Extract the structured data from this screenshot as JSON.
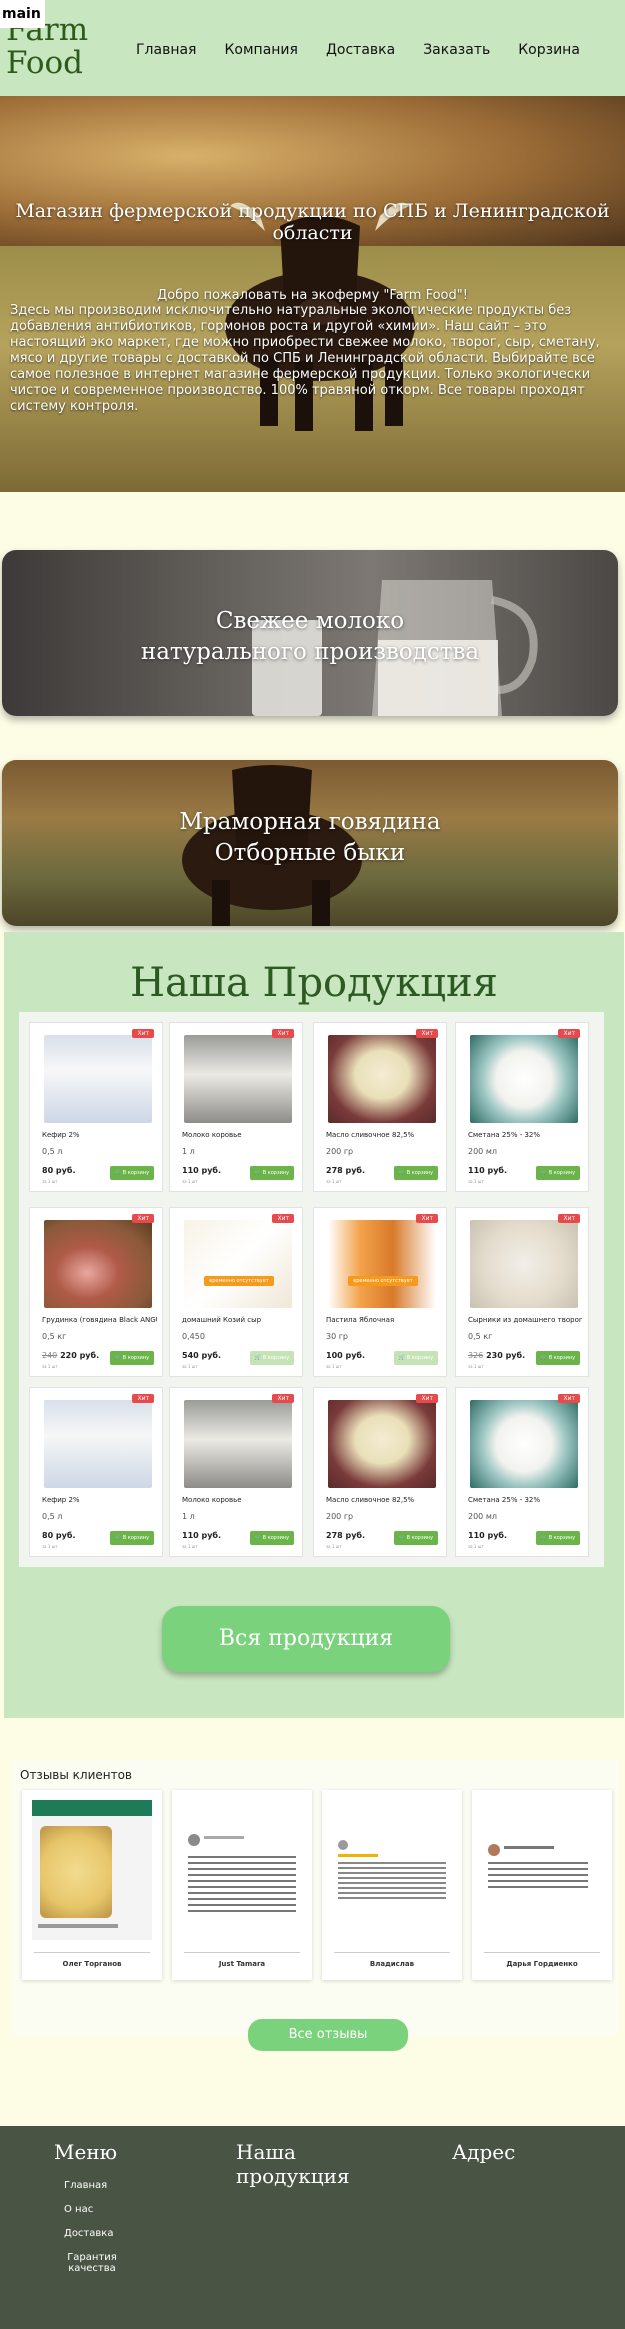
{
  "skip_link": "main",
  "header": {
    "logo_line1": "Farm",
    "logo_line2": "Food",
    "nav": [
      "Главная",
      "Компания",
      "Доставка",
      "Заказать",
      "Корзина"
    ]
  },
  "hero": {
    "title": "Магазин фермерской продукции по СПБ и Ленинградской области",
    "welcome": "Добро пожаловать на экоферму \"Farm Food\"!",
    "description": "Здесь мы производим исключительно натуральные экологические продукты без добавления антибиотиков, гормонов роста и другой «химии». Наш сайт – это настоящий эко маркет, где можно приобрести свежее молоко, творог, сыр, сметану, мясо и другие товары с доставкой по СПБ и Ленинградской области. Выбирайте все самое полезное в интернет магазине фермерской продукции. Только экологически чистое и современное производство. 100% травяной откорм. Все товары проходят систему контроля."
  },
  "banners": [
    {
      "line1": "Свежее молоко",
      "line2": "натурального производства"
    },
    {
      "line1": "Мраморная говядина",
      "line2": "Отборные быки"
    }
  ],
  "products": {
    "title": "Наша Продукция",
    "badge": "Хит",
    "cart_label": "В корзину",
    "out_of_stock_label": "временно отсутствует",
    "stock_label": "за 1 шт",
    "items": [
      {
        "name": "Кефир 2%",
        "weight": "0,5 л",
        "price": "80 руб.",
        "old_price": "",
        "img": "kefir"
      },
      {
        "name": "Молоко коровье",
        "weight": "1 л",
        "price": "110 руб.",
        "old_price": "",
        "img": "milk"
      },
      {
        "name": "Масло сливочное 82,5%",
        "weight": "200 гр",
        "price": "278 руб.",
        "old_price": "",
        "img": "butter"
      },
      {
        "name": "Сметана 25% - 32%",
        "weight": "200 мл",
        "price": "110 руб.",
        "old_price": "",
        "img": "cream"
      },
      {
        "name": "Грудинка (говядина Black ANGUS)",
        "weight": "0,5 кг",
        "price": "220 руб.",
        "old_price": "240",
        "img": "brisket"
      },
      {
        "name": "домашний Козий сыр",
        "weight": "0,450",
        "price": "540 руб.",
        "old_price": "",
        "img": "cheese",
        "out": true
      },
      {
        "name": "Пастила Яблочная",
        "weight": "30 гр",
        "price": "100 руб.",
        "old_price": "",
        "img": "pastila",
        "out": true
      },
      {
        "name": "Сырники из домашнего творога",
        "weight": "0,5 кг",
        "price": "230 руб.",
        "old_price": "326",
        "img": "syrniki"
      },
      {
        "name": "Кефир 2%",
        "weight": "0,5 л",
        "price": "80 руб.",
        "old_price": "",
        "img": "kefir"
      },
      {
        "name": "Молоко коровье",
        "weight": "1 л",
        "price": "110 руб.",
        "old_price": "",
        "img": "milk"
      },
      {
        "name": "Масло сливочное 82,5%",
        "weight": "200 гр",
        "price": "278 руб.",
        "old_price": "",
        "img": "butter"
      },
      {
        "name": "Сметана 25% - 32%",
        "weight": "200 мл",
        "price": "110 руб.",
        "old_price": "",
        "img": "cream"
      }
    ],
    "all_button": "Вся продукция"
  },
  "reviews": {
    "title": "Отзывы клиентов",
    "items": [
      {
        "name": "Олег Торганов"
      },
      {
        "name": "Just Tamara"
      },
      {
        "name": "Владислав"
      },
      {
        "name": "Дарья Гордиенко"
      }
    ],
    "all_button": "Все отзывы"
  },
  "footer": {
    "menu_title": "Меню",
    "menu_items": [
      "Главная",
      "О нас",
      "Доставка",
      "Гарантия качества"
    ],
    "products_title": "Наша продукция",
    "address_title": "Адрес"
  }
}
